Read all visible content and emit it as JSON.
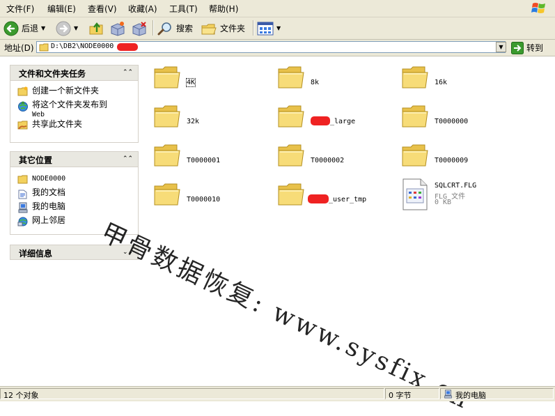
{
  "menu": {
    "items": [
      "文件(F)",
      "编辑(E)",
      "查看(V)",
      "收藏(A)",
      "工具(T)",
      "帮助(H)"
    ]
  },
  "toolbar": {
    "back": "后退",
    "search": "搜索",
    "folders": "文件夹"
  },
  "address": {
    "label": "地址(D)",
    "value": "D:\\DB2\\NODE0000",
    "go": "转到"
  },
  "tasks": {
    "file_tasks": {
      "title": "文件和文件夹任务",
      "items": [
        "创建一个新文件夹",
        "将这个文件夹发布到",
        "Web",
        "共享此文件夹"
      ]
    },
    "other_places": {
      "title": "其它位置",
      "items": [
        "NODE0000",
        "我的文档",
        "我的电脑",
        "网上邻居"
      ]
    },
    "details": {
      "title": "详细信息"
    }
  },
  "files": {
    "items": [
      {
        "name": "4K"
      },
      {
        "name": "8k"
      },
      {
        "name": "16k"
      },
      {
        "name": "32k"
      },
      {
        "name": "_large"
      },
      {
        "name": "T0000000"
      },
      {
        "name": "T0000001"
      },
      {
        "name": "T0000002"
      },
      {
        "name": "T0000009"
      },
      {
        "name": "T0000010"
      },
      {
        "name": "_user_tmp"
      },
      {
        "name": "SQLCRT.FLG",
        "type": "FLG 文件",
        "size": "0 KB"
      }
    ]
  },
  "watermark": "甲骨数据恢复: www.sysfix.cn",
  "status": {
    "objects": "12 个对象",
    "bytes": "0 字节",
    "zone": "我的电脑"
  },
  "colors": {
    "chrome": "#ece9d8",
    "folder_yellow": "#f5d76a",
    "redaction": "#ef2222"
  }
}
